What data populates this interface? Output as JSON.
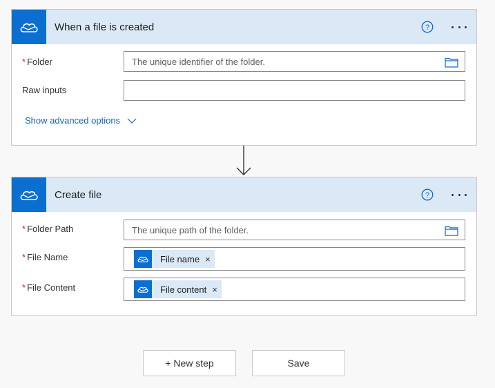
{
  "trigger": {
    "title": "When a file is created",
    "icon": "onedrive-cloud-icon",
    "help_icon": "help-circle-icon",
    "more_icon": "more-dots-icon",
    "fields": {
      "folder_label": "Folder",
      "folder_placeholder": "The unique identifier of the folder.",
      "raw_inputs_label": "Raw inputs",
      "raw_inputs_value": ""
    },
    "advanced_label": "Show advanced options"
  },
  "action": {
    "title": "Create file",
    "icon": "onedrive-cloud-icon",
    "help_icon": "help-circle-icon",
    "more_icon": "more-dots-icon",
    "fields": {
      "folder_path_label": "Folder Path",
      "folder_path_placeholder": "The unique path of the folder.",
      "file_name_label": "File Name",
      "file_name_token": "File name",
      "file_content_label": "File Content",
      "file_content_token": "File content"
    }
  },
  "required_marker": "*",
  "token_close": "×",
  "buttons": {
    "new_step": "+ New step",
    "save": "Save"
  },
  "colors": {
    "accent": "#0a6fd0",
    "header_bg": "#dbe9f7",
    "link": "#1565c0",
    "required": "#c4262e"
  }
}
